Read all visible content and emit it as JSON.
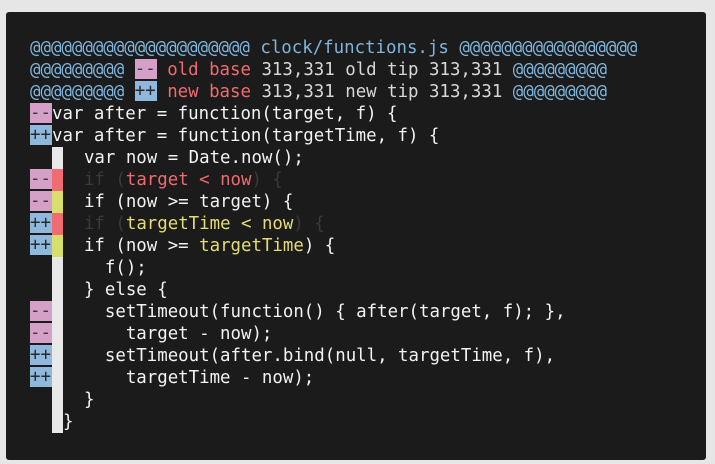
{
  "header": {
    "file_line": {
      "left": "@@@@@@@@@@@@@@@@@@@@@",
      "file": "clock/functions.js",
      "right": "@@@@@@@@@@@@@@@@@"
    },
    "old_line": {
      "left": "@@@@@@@@@",
      "marker": "--",
      "label": "old base",
      "base": "313,331",
      "tip_label": "old tip",
      "tip": "313,331",
      "right": "@@@@@@@@@"
    },
    "new_line": {
      "left": "@@@@@@@@@",
      "marker": "++",
      "label": "new base",
      "base": "313,331",
      "tip_label": "new tip",
      "tip": "313,331",
      "right": "@@@@@@@@@"
    }
  },
  "lines": [
    {
      "marker": "--",
      "kind": "del",
      "code": "var after = function(target, f) {"
    },
    {
      "marker": "++",
      "kind": "add",
      "code": "var after = function(targetTime, f) {"
    },
    {
      "marker": "",
      "kind": "ctx",
      "code": "  var now = Date.now();"
    },
    {
      "marker": "--",
      "kind": "del",
      "pre": "  ",
      "ghost_a": "if (",
      "hl": "target < now",
      "ghost_b": ") {"
    },
    {
      "marker": "--",
      "kind": "del",
      "code": "  if (now >= target) {"
    },
    {
      "marker": "++",
      "kind": "add",
      "pre": "  ",
      "ghost_a": "if (",
      "hl": "targetTime < now",
      "ghost_b": ") {"
    },
    {
      "marker": "++",
      "kind": "add",
      "pre": "  if (now >= ",
      "hl": "targetTime",
      "post": ") {"
    },
    {
      "marker": "",
      "kind": "ctx",
      "code": "    f();"
    },
    {
      "marker": "",
      "kind": "ctx",
      "code": "  } else {"
    },
    {
      "marker": "--",
      "kind": "del",
      "code": "    setTimeout(function() { after(target, f); },"
    },
    {
      "marker": "--",
      "kind": "del",
      "code": "      target - now);"
    },
    {
      "marker": "++",
      "kind": "add",
      "code": "    setTimeout(after.bind(null, targetTime, f),"
    },
    {
      "marker": "++",
      "kind": "add",
      "code": "      targetTime - now);"
    },
    {
      "marker": "",
      "kind": "ctx",
      "code": "  }"
    },
    {
      "marker": "",
      "kind": "ctx",
      "code": "}"
    }
  ]
}
